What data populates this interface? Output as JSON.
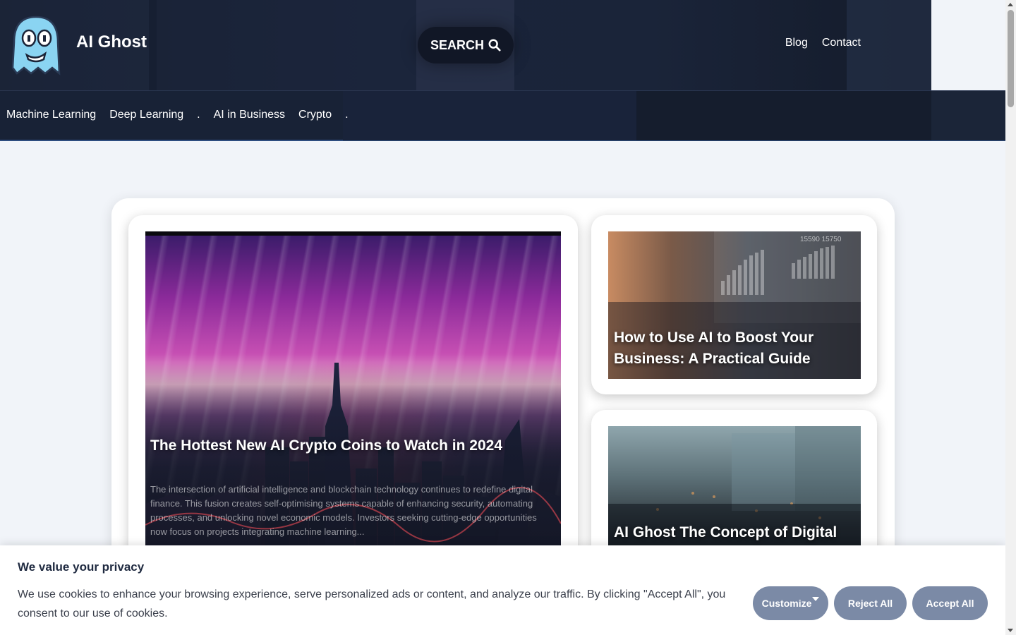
{
  "site": {
    "title": "AI Ghost",
    "logo_icon": "ghost-icon"
  },
  "header": {
    "search_label": "SEARCH",
    "links": [
      {
        "label": "Blog"
      },
      {
        "label": "Contact"
      }
    ]
  },
  "categories": [
    {
      "label": "Machine Learning"
    },
    {
      "label": "Deep Learning"
    },
    {
      "label": "."
    },
    {
      "label": "AI in Business"
    },
    {
      "label": "Crypto"
    },
    {
      "label": "."
    }
  ],
  "featured": {
    "title": "The Hottest New AI Crypto Coins to Watch in 2024",
    "excerpt": "The intersection of artificial intelligence and blockchain technology continues to redefine digital finance. This fusion creates self-optimising systems capable of enhancing security, automating processes, and unlocking novel economic models. Investors seeking cutting-edge opportunities now focus on projects integrating machine learning..."
  },
  "side_posts": [
    {
      "title": "How to Use AI to Boost Your Business: A Practical Guide",
      "image_numbers": "15590 15750"
    },
    {
      "title": "AI Ghost The Concept of Digital"
    }
  ],
  "cookie": {
    "title": "We value your privacy",
    "text": "We use cookies to enhance your browsing experience, serve personalized ads or content, and analyze our traffic. By clicking \"Accept All\", you consent to our use of cookies.",
    "customize": "Customize",
    "reject": "Reject All",
    "accept": "Accept All"
  },
  "colors": {
    "header_bg": "#182236",
    "button": "#7b8aa6",
    "page_bg": "#f1f4f9"
  }
}
